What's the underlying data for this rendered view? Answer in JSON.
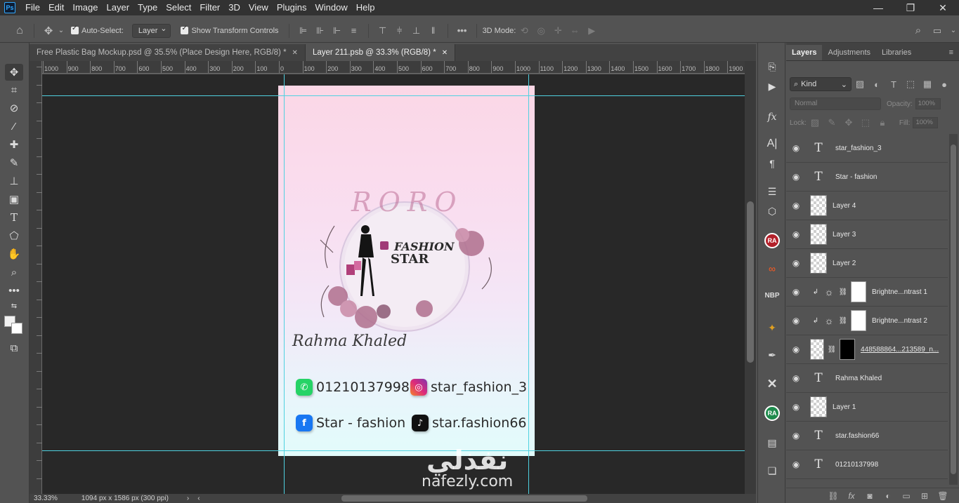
{
  "menubar": {
    "logo": "Ps",
    "items": [
      "File",
      "Edit",
      "Image",
      "Layer",
      "Type",
      "Select",
      "Filter",
      "3D",
      "View",
      "Plugins",
      "Window",
      "Help"
    ],
    "window_controls": [
      "minimize-icon",
      "restore-icon",
      "close-icon"
    ]
  },
  "options_bar": {
    "auto_select_label": "Auto-Select:",
    "auto_select_target": "Layer",
    "show_transform_label": "Show Transform Controls",
    "mode_3d_label": "3D Mode:",
    "more_label": "•••"
  },
  "tabs": [
    {
      "label": "Free Plastic Bag Mockup.psd @ 35.5% (Place Design Here, RGB/8) *",
      "active": false
    },
    {
      "label": "Layer 211.psb @ 33.3% (RGB/8) *",
      "active": true
    }
  ],
  "ruler": {
    "h_labels": [
      "1000",
      "900",
      "800",
      "700",
      "600",
      "500",
      "400",
      "300",
      "200",
      "100",
      "0",
      "100",
      "200",
      "300",
      "400",
      "500",
      "600",
      "700",
      "800",
      "900",
      "1000",
      "1100",
      "1200",
      "1300",
      "1400",
      "1500",
      "1600",
      "1700",
      "1800",
      "1900"
    ]
  },
  "artwork": {
    "brand_top": "RORO",
    "brand_line1": "FASHION",
    "brand_line2": "STAR",
    "signature": "Rahma Khaled",
    "contacts": [
      {
        "icon": "whatsapp-icon",
        "text": "01210137998",
        "color": "#25d366"
      },
      {
        "icon": "instagram-icon",
        "text": "star_fashion_3",
        "color": "#c13584"
      },
      {
        "icon": "facebook-icon",
        "text": "Star - fashion",
        "color": "#1877f2"
      },
      {
        "icon": "tiktok-icon",
        "text": "star.fashion66",
        "color": "#111111"
      }
    ]
  },
  "watermark": {
    "arabic": "نفذلي",
    "english": "nafezly.com"
  },
  "status": {
    "zoom": "33.33%",
    "doc_info": "1094 px x 1586 px (300 ppi)"
  },
  "layers_panel": {
    "tabs": [
      "Layers",
      "Adjustments",
      "Libraries"
    ],
    "active_tab": "Layers",
    "filter_kind": "Kind",
    "blend_mode": "Normal",
    "opacity_label": "Opacity:",
    "opacity_value": "100%",
    "lock_label": "Lock:",
    "fill_label": "Fill:",
    "fill_value": "100%",
    "layers": [
      {
        "name": "star_fashion_3",
        "kind": "text"
      },
      {
        "name": "Star - fashion",
        "kind": "text"
      },
      {
        "name": "Layer 4",
        "kind": "pixel"
      },
      {
        "name": "Layer 3",
        "kind": "pixel"
      },
      {
        "name": "Layer 2",
        "kind": "pixel"
      },
      {
        "name": "Brightne...ntrast 1",
        "kind": "adjustment"
      },
      {
        "name": "Brightne...ntrast 2",
        "kind": "adjustment"
      },
      {
        "name": "448588864...213589_n...",
        "kind": "smart"
      },
      {
        "name": "Rahma Khaled",
        "kind": "text"
      },
      {
        "name": "Layer 1",
        "kind": "pixel"
      },
      {
        "name": "star.fashion66",
        "kind": "text"
      },
      {
        "name": "01210137998",
        "kind": "text"
      }
    ]
  },
  "colors": {
    "guide": "#4fd1e0",
    "accent": "#31a8ff",
    "ra_badge_red": "#b3202a",
    "ra_badge_green": "#1e8a4c"
  }
}
